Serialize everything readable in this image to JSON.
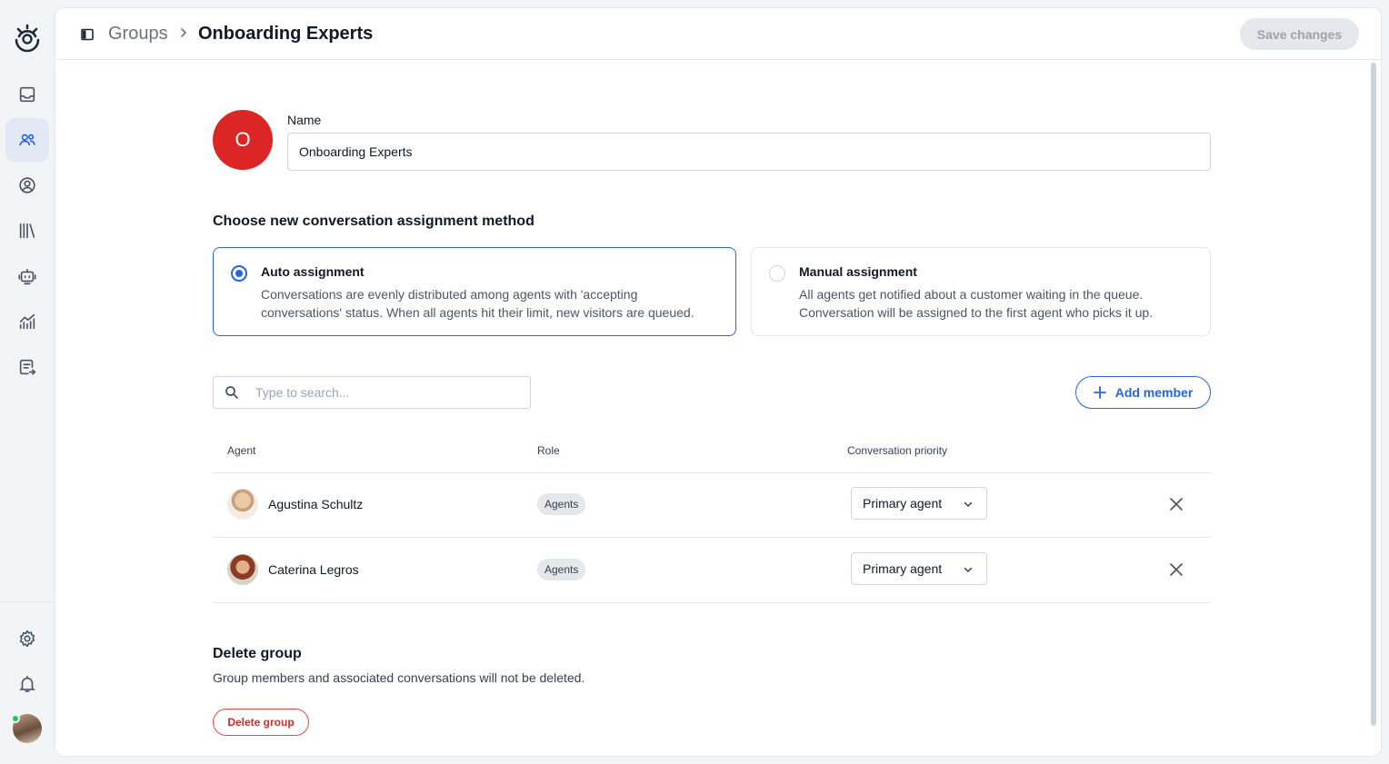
{
  "sidebar": {
    "logo": "brand-logo",
    "items": [
      {
        "name": "inbox",
        "icon": "inbox-icon",
        "active": false
      },
      {
        "name": "groups",
        "icon": "users-icon",
        "active": true
      },
      {
        "name": "contacts",
        "icon": "user-circle-icon",
        "active": false
      },
      {
        "name": "knowledge",
        "icon": "library-icon",
        "active": false
      },
      {
        "name": "bots",
        "icon": "bot-icon",
        "active": false
      },
      {
        "name": "reports",
        "icon": "chart-icon",
        "active": false
      },
      {
        "name": "canned",
        "icon": "list-arrow-icon",
        "active": false
      }
    ],
    "bottom": [
      {
        "name": "settings",
        "icon": "gear-icon"
      },
      {
        "name": "notifications",
        "icon": "bell-icon"
      }
    ],
    "accent_color": "#2563eb"
  },
  "header": {
    "breadcrumb_parent": "Groups",
    "breadcrumb_current": "Onboarding Experts",
    "save_label": "Save changes"
  },
  "group": {
    "avatar_letter": "O",
    "avatar_color": "#dc2626",
    "name_label": "Name",
    "name_value": "Onboarding Experts"
  },
  "assignment": {
    "title": "Choose new conversation assignment method",
    "options": [
      {
        "title": "Auto assignment",
        "desc_line1": "Conversations are evenly distributed among agents with 'accepting",
        "desc_line2": "conversations' status. When all agents hit their limit, new visitors are queued.",
        "selected": true
      },
      {
        "title": "Manual assignment",
        "desc_line1": "All agents get notified about a customer waiting in the queue.",
        "desc_line2": "Conversation will be assigned to the first agent who picks it up.",
        "selected": false
      }
    ]
  },
  "members": {
    "search_placeholder": "Type to search...",
    "add_label": "Add member",
    "columns": [
      "Agent",
      "Role",
      "Conversation priority"
    ],
    "rows": [
      {
        "name": "Agustina Schultz",
        "role": "Agents",
        "priority": "Primary agent"
      },
      {
        "name": "Caterina Legros",
        "role": "Agents",
        "priority": "Primary agent"
      }
    ]
  },
  "delete": {
    "title": "Delete group",
    "desc": "Group members and associated conversations will not be deleted.",
    "button": "Delete group"
  }
}
